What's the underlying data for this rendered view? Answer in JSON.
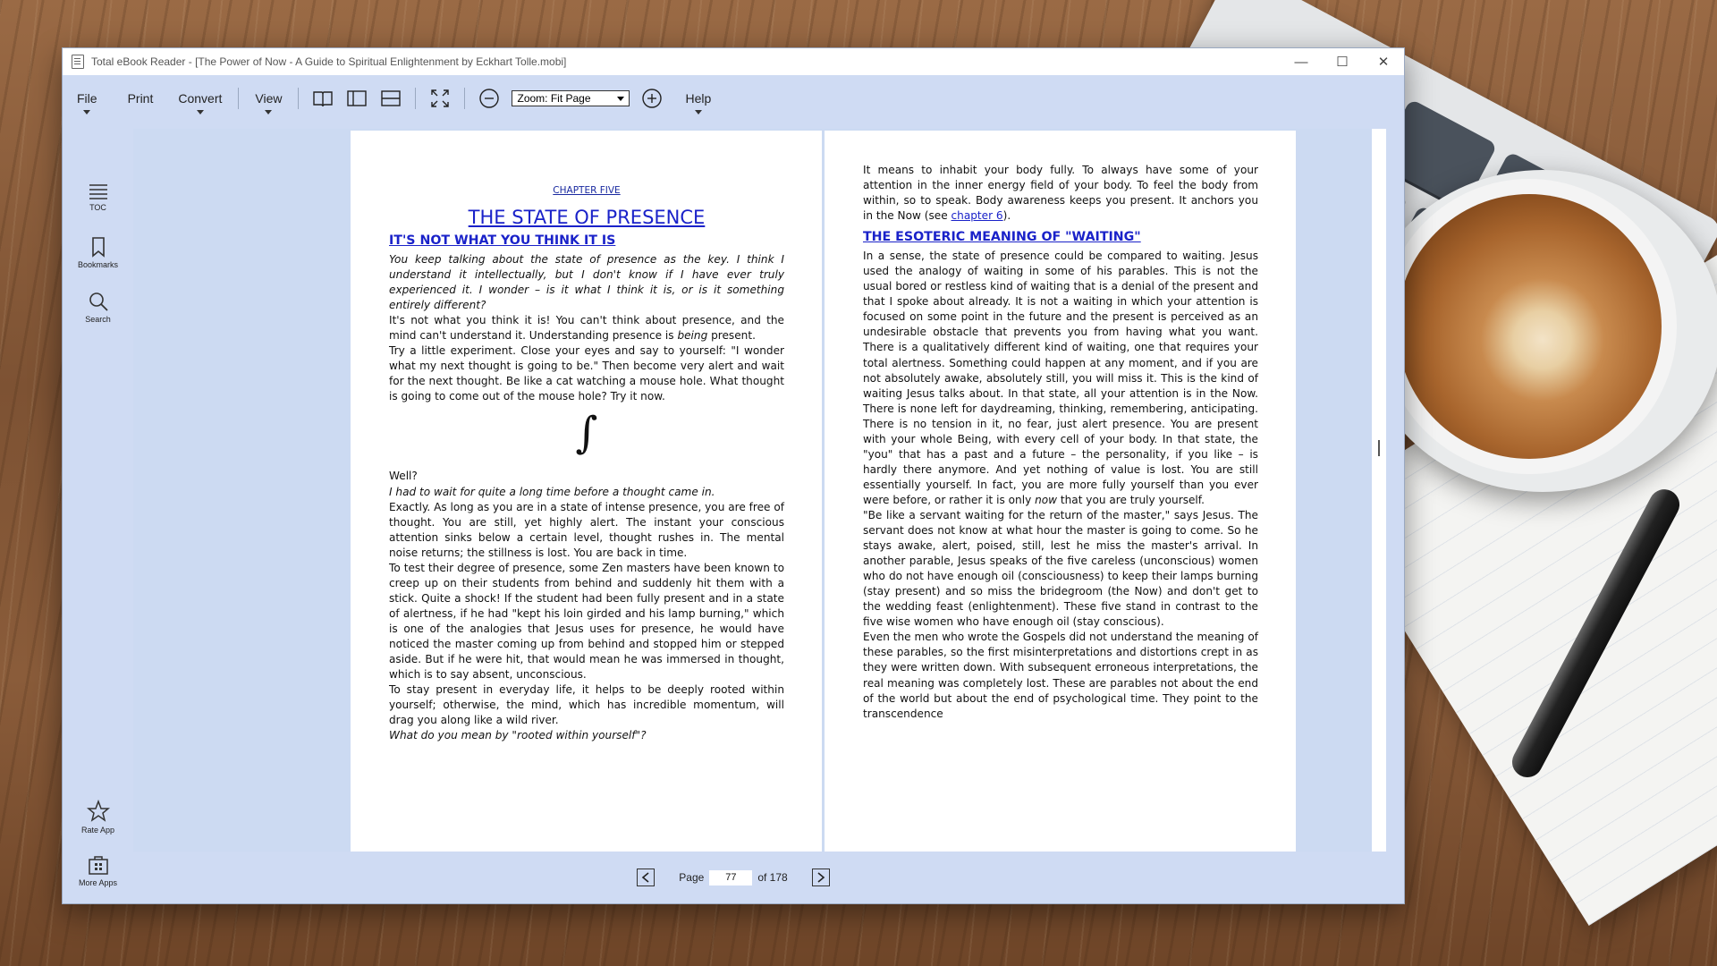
{
  "window": {
    "title": "Total eBook Reader - [The Power of Now - A Guide to Spiritual Enlightenment by Eckhart Tolle.mobi]",
    "controls": {
      "minimize": "—",
      "maximize": "☐",
      "close": "✕"
    }
  },
  "toolbar": {
    "file": "File",
    "print": "Print",
    "convert": "Convert",
    "view": "View",
    "zoom": "Zoom: Fit Page",
    "help": "Help",
    "icons": [
      "single-page-icon",
      "two-page-icon",
      "horizontal-split-icon",
      "fullscreen-icon",
      "zoom-out-icon",
      "zoom-in-icon"
    ]
  },
  "sidebar": {
    "toc": "TOC",
    "bookmarks": "Bookmarks",
    "search": "Search",
    "rate": "Rate App",
    "more": "More Apps"
  },
  "page_left": {
    "chapter_label": "CHAPTER FIVE",
    "chapter_title": "THE STATE OF PRESENCE",
    "section_head": "IT'S NOT WHAT YOU THINK IT IS",
    "p1": "You keep talking about the state of presence as the key. I think I understand it intellectually, but I don't know if I have ever truly experienced it. I wonder – is it what I think it is, or is it something entirely different?",
    "p2_a": "It's not what you think it is! You can't think about presence, and the mind can't understand it. Understanding presence is ",
    "p2_b": "being",
    "p2_c": " present.",
    "p3": "Try a little experiment. Close your eyes and say to yourself: \"I wonder what my next thought is going to be.\" Then become very alert and wait for the next thought. Be like a cat watching a mouse hole. What thought is going to come out of the mouse hole? Try it now.",
    "glyph": "∫",
    "p4": "Well?",
    "p5": "I had to wait for quite a long time before a thought came in.",
    "p6": "Exactly. As long as you are in a state of intense presence, you are free of thought. You are still, yet highly alert. The instant your conscious attention sinks below a certain level, thought rushes in. The mental noise returns; the stillness is lost. You are back in time.",
    "p7": "To test their degree of presence, some Zen masters have been known to creep up on their students from behind and suddenly hit them with a stick. Quite a shock! If the student had been fully present and in a state of alertness, if he had \"kept his loin girded and his lamp burning,\" which is one of the analogies that Jesus uses for presence, he would have noticed the master coming up from behind and stopped him or stepped aside. But if he were hit, that would mean he was immersed in thought, which is to say absent, unconscious.",
    "p8": "To stay present in everyday life, it helps to be deeply rooted within yourself; otherwise, the mind, which has incredible momentum, will drag you along like a wild river.",
    "p9": "What do you mean by \"rooted within yourself\"?"
  },
  "page_right": {
    "p1_a": "It means to inhabit your body fully. To always have some of your attention in the inner energy field of your body. To feel the body from within, so to speak. Body awareness keeps you present. It anchors you in the Now (see ",
    "p1_link": "chapter 6",
    "p1_c": ").",
    "section_head": "THE ESOTERIC MEANING OF \"WAITING\"",
    "p2_a": "In a sense, the state of presence could be compared to waiting. Jesus used the analogy of waiting in some of his parables. This is not the usual bored or restless kind of waiting that is a denial of the present and that I spoke about already. It is not a waiting in which your attention is focused on some point in the future and the present is perceived as an undesirable obstacle that prevents you from having what you want. There is a qualitatively different kind of waiting, one that requires your total alertness. Something could happen at any moment, and if you are not absolutely awake, absolutely still, you will miss it. This is the kind of waiting Jesus talks about. In that state, all your attention is in the Now. There is none left for daydreaming, thinking, remembering, anticipating. There is no tension in it, no fear, just alert presence. You are present with your whole Being, with every cell of your body. In that state, the \"you\" that has a past and a future – the personality, if you like – is hardly there anymore. And yet nothing of value is lost. You are still essentially yourself. In fact, you are more fully yourself than you ever were before, or rather it is only ",
    "p2_b": "now",
    "p2_c": " that you are truly yourself.",
    "p3": "\"Be like a servant waiting for the return of the master,\" says Jesus. The servant does not know at what hour the master is going to come. So he stays awake, alert, poised, still, lest he miss the master's arrival. In another parable, Jesus speaks of the five careless (unconscious) women who do not have enough oil (consciousness) to keep their lamps burning (stay present) and so miss the bridegroom (the Now) and don't get to the wedding feast (enlightenment). These five stand in contrast to the five wise women who have enough oil (stay conscious).",
    "p4": "Even the men who wrote the Gospels did not understand the meaning of these parables, so the first misinterpretations and distortions crept in as they were written down. With subsequent erroneous interpretations, the real meaning was completely lost. These are parables not about the end of the world but about the end of psychological time. They point to the transcendence"
  },
  "footer": {
    "page_label": "Page",
    "page_value": "77",
    "page_total": "of 178"
  }
}
